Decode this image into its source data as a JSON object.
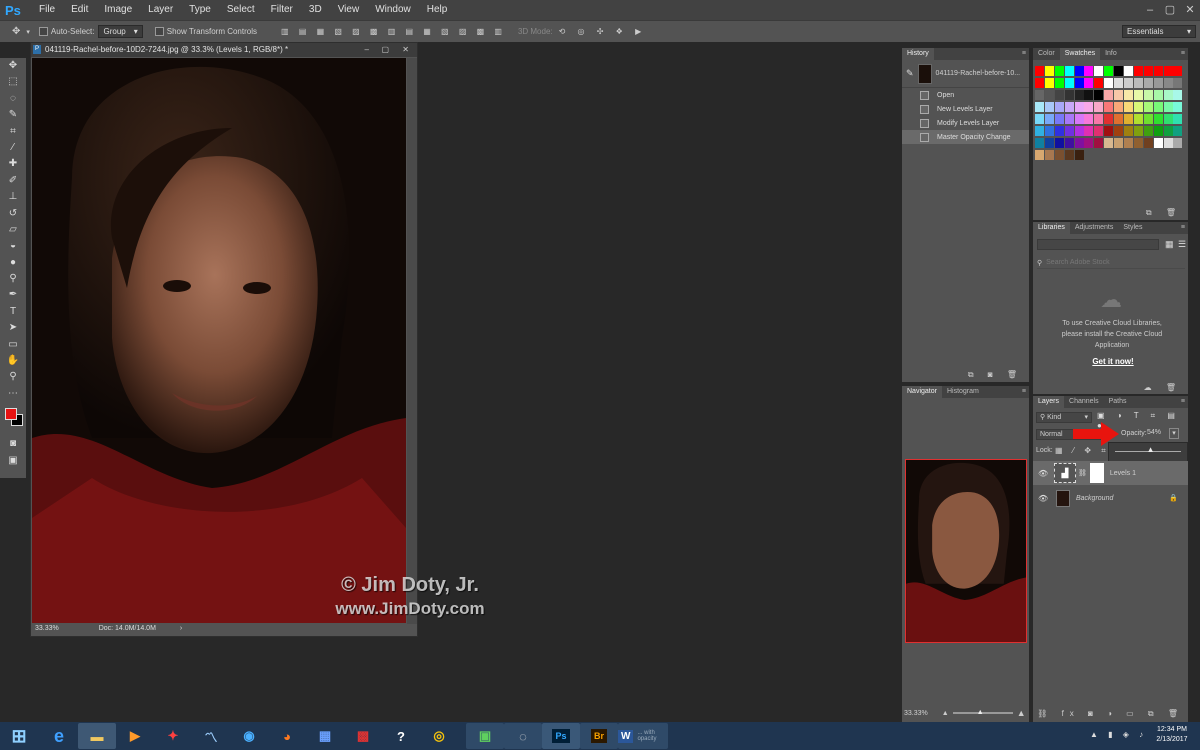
{
  "app": {
    "logo": "Ps"
  },
  "menu": [
    "File",
    "Edit",
    "Image",
    "Layer",
    "Type",
    "Select",
    "Filter",
    "3D",
    "View",
    "Window",
    "Help"
  ],
  "options": {
    "auto_select_label": "Auto-Select:",
    "auto_select_value": "Group",
    "show_transform_label": "Show Transform Controls",
    "mode_3d_label": "3D Mode:",
    "workspace": "Essentials"
  },
  "document": {
    "title": "041119-Rachel-before-10D2-7244.jpg @ 33.3% (Levels 1, RGB/8*) *",
    "zoom": "33.33%",
    "doc_size": "Doc: 14.0M/14.0M"
  },
  "history": {
    "tab": "History",
    "snapshot": "041119-Rachel-before-10...",
    "items": [
      "Open",
      "New Levels Layer",
      "Modify Levels Layer",
      "Master Opacity Change"
    ]
  },
  "swatch_panel": {
    "tabs": [
      "Color",
      "Swatches",
      "Info"
    ],
    "active": "Swatches"
  },
  "libraries": {
    "tabs": [
      "Libraries",
      "Adjustments",
      "Styles"
    ],
    "search_placeholder": "Search Adobe Stock",
    "message": "To use Creative Cloud Libraries, please install the Creative Cloud Application",
    "link": "Get it now!"
  },
  "navigator": {
    "tabs": [
      "Navigator",
      "Histogram"
    ],
    "zoom": "33.33%"
  },
  "layers": {
    "tabs": [
      "Layers",
      "Channels",
      "Paths"
    ],
    "filter": "Kind",
    "blend_mode": "Normal",
    "opacity_label": "Opacity:",
    "opacity_value": "54%",
    "opacity_fraction": 0.54,
    "lock_label": "Lock:",
    "rows": [
      {
        "name": "Levels 1",
        "selected": true
      },
      {
        "name": "Background",
        "selected": false
      }
    ]
  },
  "watermark": {
    "line1": "© Jim Doty, Jr.",
    "line2": "www.JimDoty.com"
  },
  "clock": {
    "time": "12:34 PM",
    "date": "2/13/2017"
  },
  "taskbar_hint": "... with opacity",
  "colors": {
    "accent_arrow": "#e8140e",
    "foreground": "#e61212",
    "background": "#000000"
  }
}
